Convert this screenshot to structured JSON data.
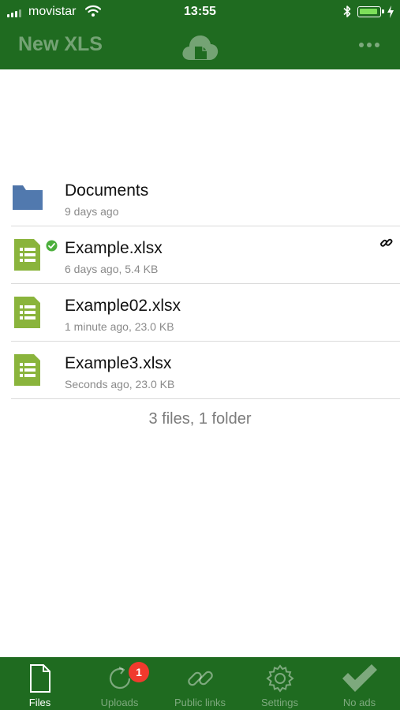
{
  "status_bar": {
    "carrier": "movistar",
    "time": "13:55",
    "battery_level": 0.8
  },
  "nav": {
    "title": "New XLS",
    "center_icon": "cloud-document-icon",
    "menu_icon": "more-icon"
  },
  "items": [
    {
      "kind": "folder",
      "name": "Documents",
      "meta": "9 days ago",
      "icon": "folder-icon",
      "synced": false,
      "shared_link": false
    },
    {
      "kind": "spreadsheet",
      "name": "Example.xlsx",
      "meta": "6 days ago, 5.4 KB",
      "icon": "spreadsheet-icon",
      "synced": true,
      "shared_link": true
    },
    {
      "kind": "spreadsheet",
      "name": "Example02.xlsx",
      "meta": "1 minute ago, 23.0 KB",
      "icon": "spreadsheet-icon",
      "synced": false,
      "shared_link": false
    },
    {
      "kind": "spreadsheet",
      "name": "Example3.xlsx",
      "meta": "Seconds ago, 23.0 KB",
      "icon": "spreadsheet-icon",
      "synced": false,
      "shared_link": false
    }
  ],
  "summary": "3 files, 1 folder",
  "tabs": [
    {
      "label": "Files",
      "icon": "file-icon",
      "active": true
    },
    {
      "label": "Uploads",
      "icon": "upload-icon",
      "active": false,
      "badge": "1"
    },
    {
      "label": "Public links",
      "icon": "link-icon",
      "active": false
    },
    {
      "label": "Settings",
      "icon": "gear-icon",
      "active": false
    },
    {
      "label": "No ads",
      "icon": "checkmark-icon",
      "active": false
    }
  ],
  "colors": {
    "brand_green": "#1f6b20",
    "folder_blue": "#4e74a8",
    "sheet_green": "#8ab43c",
    "sync_green": "#4caf3c",
    "badge_red": "#f03a2d"
  }
}
